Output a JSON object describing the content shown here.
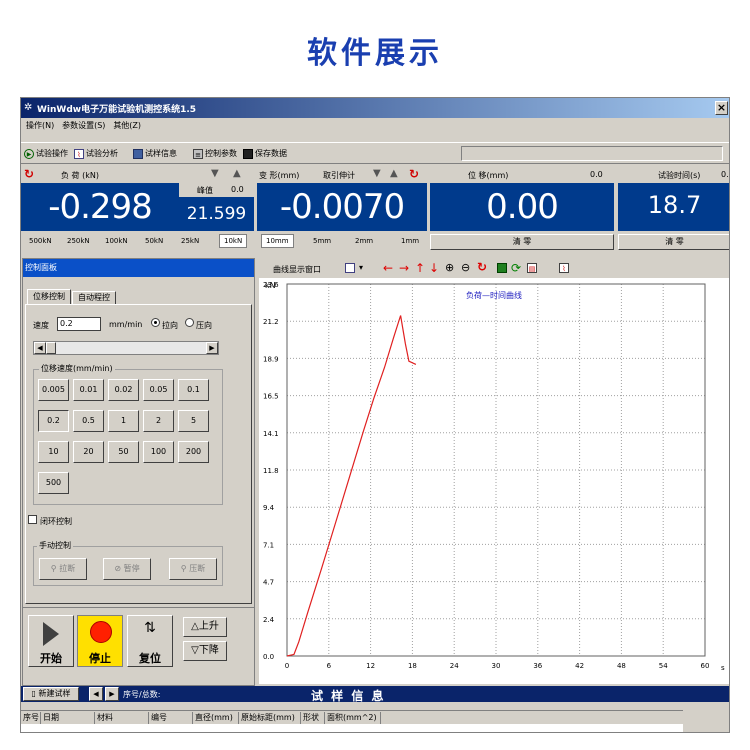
{
  "page_title": "软件展示",
  "window": {
    "title": "WinWdw电子万能试验机测控系统1.5",
    "close": "×"
  },
  "menu": [
    "操作(N)",
    "参数设置(S)",
    "其他(Z)"
  ],
  "toolbar": {
    "test_op": "试验操作",
    "test_analysis": "试验分析",
    "sample_info": "试样信息",
    "control_params": "控制参数",
    "save_data": "保存数据"
  },
  "readouts": {
    "load": {
      "label": "负  荷 (kN)",
      "value": "-0.298",
      "peak_label": "峰值",
      "peak_small": "0.0",
      "peak_value": "21.599"
    },
    "deform": {
      "label": "变 形(mm)",
      "sub": "取引伸计",
      "value": "-0.0070"
    },
    "disp": {
      "label": "位  移(mm)",
      "small": "0.0",
      "value": "0.00",
      "zero": "清  零"
    },
    "time": {
      "label": "试验时间(s)",
      "small": "0.",
      "value": "18.7",
      "zero": "清  零"
    },
    "load_ranges": [
      "500kN",
      "250kN",
      "100kN",
      "50kN",
      "25kN",
      "10kN"
    ],
    "deform_ranges": [
      "10mm",
      "5mm",
      "2mm",
      "1mm"
    ]
  },
  "control": {
    "panel_title": "控制面板",
    "tab_position": "位移控制",
    "tab_auto": "自动程控",
    "speed_label": "速度",
    "speed_value": "0.2",
    "speed_unit": "mm/min",
    "dir_pull": "拉向",
    "dir_press": "压向",
    "preset_label": "位移速度(mm/min)",
    "presets": [
      "0.005",
      "0.01",
      "0.02",
      "0.05",
      "0.1",
      "0.2",
      "0.5",
      "1",
      "2",
      "5",
      "10",
      "20",
      "50",
      "100",
      "200",
      "500"
    ],
    "closed_loop": "闭环控制",
    "manual_label": "手动控制",
    "manual_buttons": [
      "拉断",
      "暂停",
      "压断"
    ],
    "start": "开始",
    "stop": "停止",
    "reset": "复位",
    "up": "上升",
    "down": "下降"
  },
  "chart_toolbar": {
    "label": "曲线显示窗口"
  },
  "bottom": {
    "new_sample": "新建试样",
    "seq_label": "序号/总数:",
    "banner": "试  样  信  息"
  },
  "grid_headers": [
    "序号",
    "日期",
    "材料",
    "编号",
    "直径(mm)",
    "原始标距(mm)",
    "形状",
    "面积(mm^2)"
  ],
  "chart_data": {
    "type": "line",
    "title": "负荷—时间曲线",
    "ylabel": "kN",
    "xlabel": "s",
    "xlim": [
      0,
      60
    ],
    "ylim": [
      0,
      23.6
    ],
    "x_ticks": [
      0,
      6,
      12,
      18,
      24,
      30,
      36,
      42,
      48,
      54,
      60
    ],
    "y_ticks": [
      "0.0",
      "2.4",
      "4.7",
      "7.1",
      "9.4",
      "11.8",
      "14.1",
      "16.5",
      "18.9",
      "21.2",
      "23.6"
    ],
    "grid": true,
    "series": [
      {
        "color": "#e02020",
        "x": [
          0,
          1.0,
          1.7,
          3.0,
          5.0,
          7.0,
          9.0,
          11.0,
          12.5,
          14.0,
          15.3,
          16.3,
          17.0,
          17.5,
          18.0,
          18.5
        ],
        "y": [
          0.0,
          0.1,
          0.9,
          2.8,
          5.6,
          8.5,
          11.4,
          14.3,
          16.4,
          18.3,
          20.2,
          21.6,
          19.8,
          18.7,
          18.6,
          18.5
        ]
      }
    ]
  }
}
